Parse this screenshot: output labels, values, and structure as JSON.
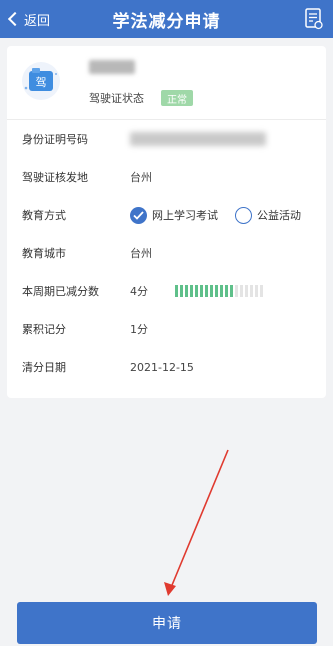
{
  "topbar": {
    "back_label": "返回",
    "title": "学法减分申请",
    "icons": {
      "back": "chevron-left-icon",
      "doc": "document-list-icon"
    }
  },
  "profile": {
    "status_label": "驾驶证状态",
    "status_badge": "正常",
    "license_icon_text": "驾",
    "status_color": "#9fd8a8"
  },
  "rows": {
    "id_label": "身份证明号码",
    "issue_place_label": "驾驶证核发地",
    "issue_place_value": "台州",
    "edu_mode_label": "教育方式",
    "edu_option_online": "网上学习考试",
    "edu_option_public": "公益活动",
    "edu_selected": "网上学习考试",
    "edu_city_label": "教育城市",
    "edu_city_value": "台州",
    "week_deduct_label": "本周期已减分数",
    "week_deduct_value": "4分",
    "accum_label": "累积记分",
    "accum_value": "1分",
    "clear_date_label": "清分日期",
    "clear_date_value": "2021-12-15"
  },
  "progress": {
    "filled": 12,
    "total": 18,
    "color_on": "#5fc08a",
    "color_off": "#e4e4e4"
  },
  "apply_button": {
    "label": "申请"
  },
  "colors": {
    "primary": "#3f74c9",
    "annotation_arrow": "#e03a2f"
  }
}
